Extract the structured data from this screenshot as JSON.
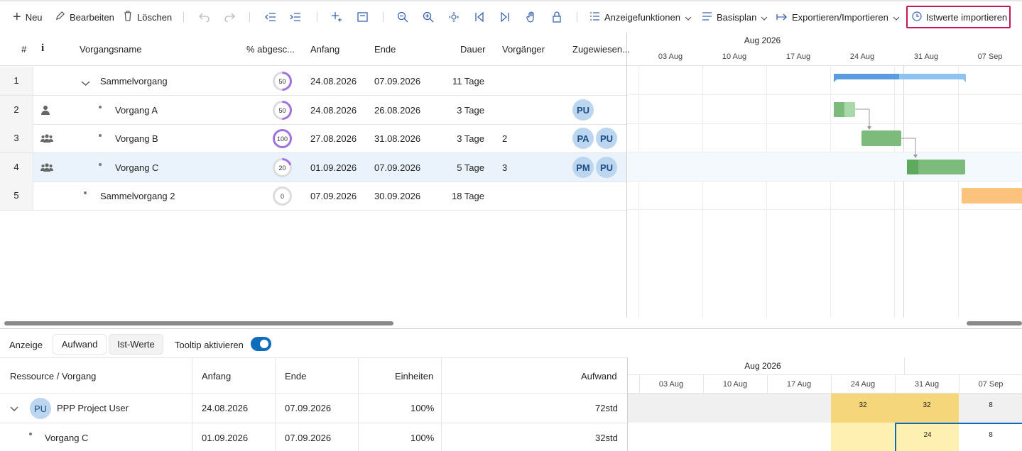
{
  "toolbar": {
    "new": "Neu",
    "edit": "Bearbeiten",
    "delete": "Löschen",
    "display": "Anzeigefunktionen",
    "baseline": "Basisplan",
    "export": "Exportieren/Importieren",
    "import_actuals": "Istwerte importieren"
  },
  "grid": {
    "headers": {
      "num": "#",
      "info": "i",
      "name": "Vorgangsname",
      "pct": "% abgesc...",
      "start": "Anfang",
      "end": "Ende",
      "dur": "Dauer",
      "pred": "Vorgänger",
      "assigned": "Zugewiesen..."
    },
    "rows": [
      {
        "num": "1",
        "name": "Sammelvorgang",
        "pct": "50",
        "pct_value": 50,
        "start": "24.08.2026",
        "end": "07.09.2026",
        "dur": "11 Tage",
        "pred": "",
        "res": []
      },
      {
        "num": "2",
        "name": "Vorgang A",
        "pct": "50",
        "pct_value": 50,
        "start": "24.08.2026",
        "end": "26.08.2026",
        "dur": "3 Tage",
        "pred": "",
        "res": [
          "PU"
        ]
      },
      {
        "num": "3",
        "name": "Vorgang B",
        "pct": "100",
        "pct_value": 100,
        "start": "27.08.2026",
        "end": "31.08.2026",
        "dur": "3 Tage",
        "pred": "2",
        "res": [
          "PA",
          "PU"
        ]
      },
      {
        "num": "4",
        "name": "Vorgang C",
        "pct": "20",
        "pct_value": 20,
        "start": "01.09.2026",
        "end": "07.09.2026",
        "dur": "5 Tage",
        "pred": "3",
        "res": [
          "PM",
          "PU"
        ]
      },
      {
        "num": "5",
        "name": "Sammelvorgang 2",
        "pct": "0",
        "pct_value": 0,
        "start": "07.09.2026",
        "end": "30.09.2026",
        "dur": "18 Tage",
        "pred": "",
        "res": []
      }
    ]
  },
  "gantt": {
    "month": "Aug 2026",
    "weeks": [
      "03 Aug",
      "10 Aug",
      "17 Aug",
      "24 Aug",
      "31 Aug",
      "07 Sep"
    ]
  },
  "bottom": {
    "display_label": "Anzeige",
    "tab_effort": "Aufwand",
    "tab_actual": "Ist-Werte",
    "tooltip_label": "Tooltip aktivieren",
    "tooltip_on": true,
    "headers": {
      "res": "Ressource / Vorgang",
      "start": "Anfang",
      "end": "Ende",
      "units": "Einheiten",
      "effort": "Aufwand"
    },
    "rows": [
      {
        "avatar": "PU",
        "name": "PPP Project User",
        "start": "24.08.2026",
        "end": "07.09.2026",
        "units": "100%",
        "effort": "72std",
        "cells": [
          "32",
          "32",
          "8"
        ]
      },
      {
        "name": "Vorgang C",
        "start": "01.09.2026",
        "end": "07.09.2026",
        "units": "100%",
        "effort": "32std",
        "cells": [
          "24",
          "8"
        ]
      }
    ]
  },
  "colors": {
    "accent": "#0f6cbd",
    "summary_bar": "#5b9be0",
    "task_bar": "#7dbb7d",
    "task_dark": "#5ea95e",
    "orange": "#fcc37f",
    "heat": "#f5d67a",
    "heat_light": "#fdf0b0",
    "progress": "#a070e0",
    "highlight": "#c2185b"
  }
}
